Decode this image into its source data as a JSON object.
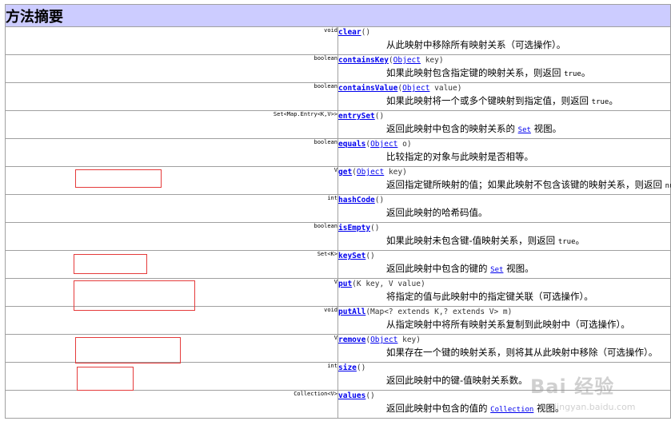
{
  "heading": "方法摘要",
  "methods": [
    {
      "ret": "void",
      "name": "clear",
      "sig": "()",
      "desc": "从此映射中移除所有映射关系（可选操作）。",
      "code": "",
      "code_link": false,
      "tail": ""
    },
    {
      "ret": "boolean",
      "name": "containsKey",
      "sig_type": "Object",
      "sig_rest": " key)",
      "desc": "如果此映射包含指定键的映射关系，则返回 ",
      "code": "true",
      "code_link": false,
      "tail": "。"
    },
    {
      "ret": "boolean",
      "name": "containsValue",
      "sig_type": "Object",
      "sig_rest": " value)",
      "desc": "如果此映射将一个或多个键映射到指定值，则返回 ",
      "code": "true",
      "code_link": false,
      "tail": "。"
    },
    {
      "ret": "Set<Map.Entry<K,V>>",
      "name": "entrySet",
      "sig": "()",
      "desc": "返回此映射中包含的映射关系的 ",
      "code": "Set",
      "code_link": true,
      "tail": " 视图。"
    },
    {
      "ret": "boolean",
      "name": "equals",
      "sig_type": "Object",
      "sig_rest": " o)",
      "desc": "比较指定的对象与此映射是否相等。",
      "code": "",
      "code_link": false,
      "tail": ""
    },
    {
      "ret": "V",
      "name": "get",
      "sig_type": "Object",
      "sig_rest": " key)",
      "desc": "返回指定键所映射的值；如果此映射不包含该键的映射关系，则返回 ",
      "code": "null",
      "code_link": false,
      "tail": "。"
    },
    {
      "ret": "int",
      "name": "hashCode",
      "sig": "()",
      "desc": "返回此映射的哈希码值。",
      "code": "",
      "code_link": false,
      "tail": ""
    },
    {
      "ret": "boolean",
      "name": "isEmpty",
      "sig": "()",
      "desc": "如果此映射未包含键-值映射关系，则返回 ",
      "code": "true",
      "code_link": false,
      "tail": "。"
    },
    {
      "ret": "Set<K>",
      "name": "keySet",
      "sig": "()",
      "desc": "返回此映射中包含的键的 ",
      "code": "Set",
      "code_link": true,
      "tail": " 视图。"
    },
    {
      "ret": "V",
      "name": "put",
      "sig": "(K key, V value)",
      "desc": "将指定的值与此映射中的指定键关联（可选操作）。",
      "code": "",
      "code_link": false,
      "tail": ""
    },
    {
      "ret": "void",
      "name": "putAll",
      "sig": "(Map<? extends K,? extends V> m)",
      "desc": "从指定映射中将所有映射关系复制到此映射中（可选操作）。",
      "code": "",
      "code_link": false,
      "tail": ""
    },
    {
      "ret": "V",
      "name": "remove",
      "sig_type": "Object",
      "sig_rest": " key)",
      "desc": "如果存在一个键的映射关系，则将其从此映射中移除（可选操作）。",
      "code": "",
      "code_link": false,
      "tail": ""
    },
    {
      "ret": "int",
      "name": "size",
      "sig": "()",
      "desc": "返回此映射中的键-值映射关系数。",
      "code": "",
      "code_link": false,
      "tail": ""
    },
    {
      "ret": "Collection<V>",
      "name": "values",
      "sig": "()",
      "desc": "返回此映射中包含的值的 ",
      "code": "Collection",
      "code_link": true,
      "tail": " 视图。"
    }
  ],
  "watermark": {
    "brand": "Bai 经验",
    "url": "jingyan.baidu.com"
  },
  "colors": {
    "header_bg": "#ccccff",
    "link": "#0000ee",
    "highlight": "#e53b3b",
    "border": "#a0a0a0"
  }
}
